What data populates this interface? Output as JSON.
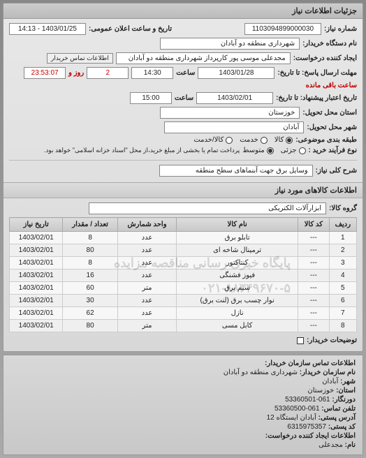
{
  "panel1": {
    "title": "جزئیات اطلاعات نیاز",
    "reqnum_label": "شماره نیاز:",
    "reqnum": "1103094899000030",
    "pubdate_label": "تاریخ و ساعت اعلان عمومی:",
    "pubdate": "1403/01/25 - 14:13",
    "buyer_device_label": "نام دستگاه خریدار:",
    "buyer_device": "شهرداری منطقه دو آبادان",
    "creator_label": "ایجاد کننده درخواست:",
    "creator": "مجدعلی موسی پور کارپرداز شهرداری منطقه دو آبادان",
    "contact_btn": "اطلاعات تماس خریدار",
    "deadline_label": "مهلت ارسال پاسخ: تا تاریخ:",
    "deadline_date": "1403/01/28",
    "time_label": "ساعت",
    "deadline_time": "14:30",
    "days_remain": "2",
    "days_remain_label": "روز و",
    "time_remain": "23:53:07",
    "time_remain_label": "ساعت باقی مانده",
    "validity_label": "تاریخ اعتبار پیشنهاد: تا تاریخ:",
    "validity_date": "1403/02/01",
    "validity_time": "15:00",
    "province_label": "استان محل تحویل:",
    "province": "خوزستان",
    "city_label": "شهر محل تحویل:",
    "city": "آبادان",
    "classify_label": "طبقه بندی موضوعی:",
    "radio1": "کالا",
    "radio2": "خدمت",
    "radio3": "کالا/خدمت",
    "process_label": "نوع فرآیند خرید :",
    "proc1": "جزئی",
    "proc2": "متوسط",
    "proc_note": "پرداخت تمام یا بخشی از مبلغ خرید،از محل \"اسناد خزانه اسلامی\" خواهد بود.",
    "desc_label": "شرح کلی نیاز:",
    "desc": "وسایل برق جهت آبنماهای سطح منطقه"
  },
  "panel2": {
    "title": "اطلاعات کالاهای مورد نیاز",
    "group_label": "گروه کالا:",
    "group": "ابزارآلات الکتریکی"
  },
  "table": {
    "headers": [
      "ردیف",
      "کد کالا",
      "نام کالا",
      "واحد شمارش",
      "تعداد / مقدار",
      "تاریخ نیاز"
    ],
    "rows": [
      {
        "n": "1",
        "code": "---",
        "name": "تابلو برق",
        "unit": "عدد",
        "qty": "8",
        "date": "1403/02/01"
      },
      {
        "n": "2",
        "code": "---",
        "name": "ترمینال شاخه ای",
        "unit": "عدد",
        "qty": "80",
        "date": "1403/02/01"
      },
      {
        "n": "3",
        "code": "---",
        "name": "کنتاکتور",
        "unit": "عدد",
        "qty": "8",
        "date": "1403/02/01",
        "wm": "پایگاه خبری رسانی مناقصه مزایده"
      },
      {
        "n": "4",
        "code": "---",
        "name": "فیوز فشنگی",
        "unit": "عدد",
        "qty": "16",
        "date": "1403/02/01"
      },
      {
        "n": "5",
        "code": "---",
        "name": "سیم برق",
        "unit": "متر",
        "qty": "60",
        "date": "1403/02/01",
        "wm": "۰۲۱-۸۸۳۴۹۶۷۰-۵"
      },
      {
        "n": "6",
        "code": "---",
        "name": "نوار چسب برق (لنت برق)",
        "unit": "عدد",
        "qty": "30",
        "date": "1403/02/01"
      },
      {
        "n": "7",
        "code": "---",
        "name": "نازل",
        "unit": "عدد",
        "qty": "62",
        "date": "1403/02/01"
      },
      {
        "n": "8",
        "code": "---",
        "name": "کابل مسی",
        "unit": "متر",
        "qty": "80",
        "date": "1403/02/01"
      }
    ],
    "buyer_notes_label": "توضیحات خریدار:"
  },
  "footer": {
    "title": "اطلاعات تماس سازمان خریدار:",
    "org_label": "نام سازمان خریدار:",
    "org": "شهرداری منطقه دو آبادان",
    "city_label": "شهر:",
    "city": "آبادان",
    "province_label": "استان:",
    "province": "خوزستان",
    "fax_label": "دورنگار:",
    "fax": "061-53360501",
    "phone_label": "تلفن تماس:",
    "phone": "061-53360500",
    "address_label": "آدرس پستی:",
    "address": "آبادان ایستگاه 12",
    "postal_label": "کد پستی:",
    "postal": "6315975357",
    "creator_section": "اطلاعات ایجاد کننده درخواست:",
    "name_label": "نام:",
    "name": "مجدعلی"
  }
}
